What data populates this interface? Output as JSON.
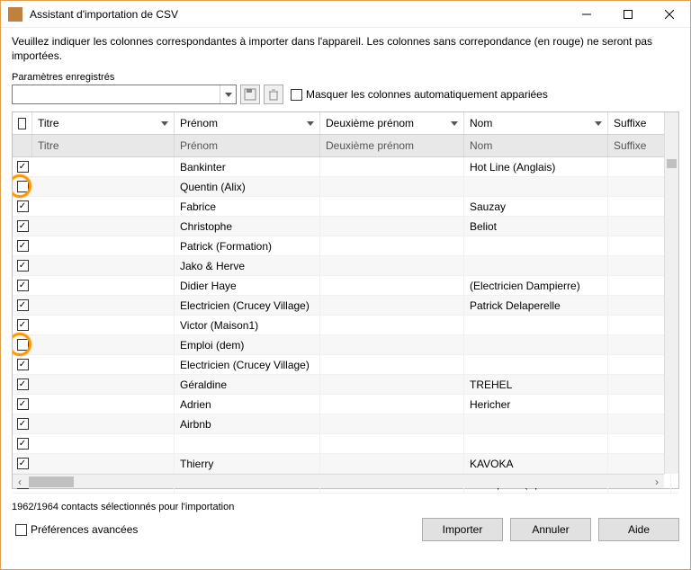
{
  "window": {
    "title": "Assistant d'importation de CSV"
  },
  "instruction": "Veuillez indiquer les colonnes correspondantes à importer dans l'appareil. Les colonnes sans correpondance (en rouge) ne seront pas importées.",
  "params_label": "Paramètres enregistrés",
  "hide_auto_label": "Masquer les colonnes automatiquement appariées",
  "columns": {
    "titre": "Titre",
    "prenom": "Prénom",
    "deux": "Deuxième prénom",
    "nom": "Nom",
    "suffixe": "Suffixe"
  },
  "subcolumns": {
    "titre": "Titre",
    "prenom": "Prénom",
    "deux": "Deuxième prénom",
    "nom": "Nom",
    "suffixe": "Suffixe"
  },
  "rows": [
    {
      "checked": true,
      "titre": "",
      "prenom": "Bankinter",
      "deux": "",
      "nom": "Hot Line (Anglais)",
      "suffixe": "",
      "ring": false
    },
    {
      "checked": false,
      "titre": "",
      "prenom": "Quentin (Alix)",
      "deux": "",
      "nom": "",
      "suffixe": "",
      "ring": true
    },
    {
      "checked": true,
      "titre": "",
      "prenom": "Fabrice",
      "deux": "",
      "nom": "Sauzay",
      "suffixe": "",
      "ring": false
    },
    {
      "checked": true,
      "titre": "",
      "prenom": "Christophe",
      "deux": "",
      "nom": "Beliot",
      "suffixe": "",
      "ring": false
    },
    {
      "checked": true,
      "titre": "",
      "prenom": "Patrick (Formation)",
      "deux": "",
      "nom": "",
      "suffixe": "",
      "ring": false
    },
    {
      "checked": true,
      "titre": "",
      "prenom": "Jako & Herve",
      "deux": "",
      "nom": "",
      "suffixe": "",
      "ring": false
    },
    {
      "checked": true,
      "titre": "",
      "prenom": "Didier Haye",
      "deux": "",
      "nom": "(Electricien Dampierre)",
      "suffixe": "",
      "ring": false
    },
    {
      "checked": true,
      "titre": "",
      "prenom": "Electricien (Crucey Village)",
      "deux": "",
      "nom": "Patrick Delaperelle",
      "suffixe": "",
      "ring": false
    },
    {
      "checked": true,
      "titre": "",
      "prenom": "Victor (Maison1)",
      "deux": "",
      "nom": "",
      "suffixe": "",
      "ring": false
    },
    {
      "checked": false,
      "titre": "",
      "prenom": "Emploi (dem)",
      "deux": "",
      "nom": "",
      "suffixe": "",
      "ring": true
    },
    {
      "checked": true,
      "titre": "",
      "prenom": "Electricien (Crucey Village)",
      "deux": "",
      "nom": "",
      "suffixe": "",
      "ring": false
    },
    {
      "checked": true,
      "titre": "",
      "prenom": "Géraldine",
      "deux": "",
      "nom": "TREHEL",
      "suffixe": "",
      "ring": false
    },
    {
      "checked": true,
      "titre": "",
      "prenom": "Adrien",
      "deux": "",
      "nom": "Hericher",
      "suffixe": "",
      "ring": false
    },
    {
      "checked": true,
      "titre": "",
      "prenom": "Airbnb",
      "deux": "",
      "nom": "",
      "suffixe": "",
      "ring": false
    },
    {
      "checked": true,
      "titre": "",
      "prenom": "",
      "deux": "",
      "nom": "",
      "suffixe": "",
      "ring": false
    },
    {
      "checked": true,
      "titre": "",
      "prenom": "Thierry",
      "deux": "",
      "nom": "KAVOKA",
      "suffixe": "",
      "ring": false
    },
    {
      "checked": true,
      "titre": "",
      "prenom": "",
      "deux": "",
      "nom": "Transports (Spécial Référ…",
      "suffixe": "",
      "ring": false
    }
  ],
  "status": "1962/1964 contacts sélectionnés pour l'importation",
  "advanced_label": "Préférences avancées",
  "buttons": {
    "import": "Importer",
    "cancel": "Annuler",
    "help": "Aide"
  }
}
